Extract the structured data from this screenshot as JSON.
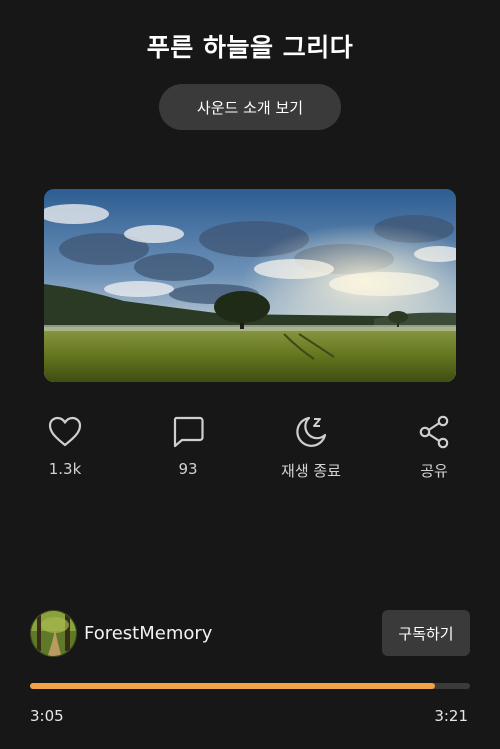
{
  "title": "푸른 하늘을 그리다",
  "intro_button": "사운드 소개 보기",
  "actions": [
    {
      "icon": "heart-icon",
      "label": "1.3k"
    },
    {
      "icon": "comment-icon",
      "label": "93"
    },
    {
      "icon": "sleep-timer-icon",
      "label": "재생 종료"
    },
    {
      "icon": "share-icon",
      "label": "공유"
    }
  ],
  "channel": {
    "name": "ForestMemory"
  },
  "subscribe_button": "구독하기",
  "player": {
    "current_time": "3:05",
    "total_time": "3:21",
    "progress": 0.92
  },
  "colors": {
    "accent": "#f3a24a",
    "button_bg": "#3a3a3a",
    "background": "#171717"
  }
}
